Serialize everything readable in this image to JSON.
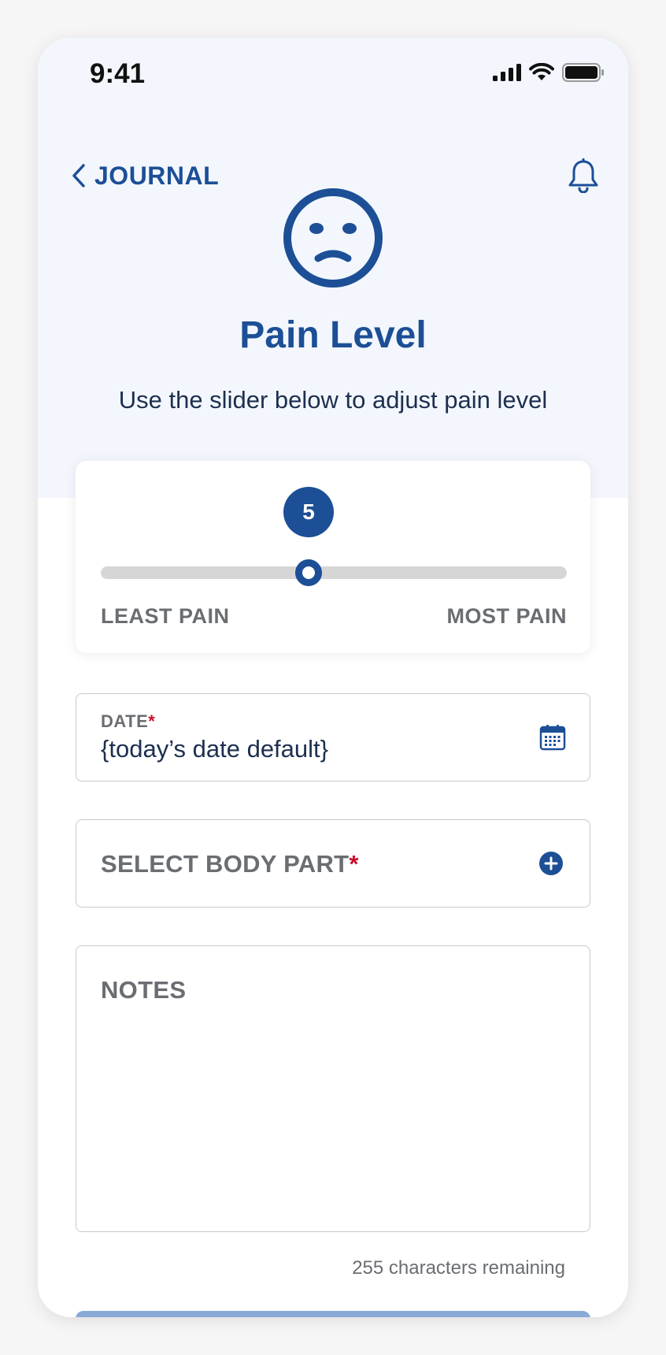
{
  "status_bar": {
    "time": "9:41",
    "icons": [
      "signal-icon",
      "wifi-icon",
      "battery-icon"
    ]
  },
  "nav": {
    "back_label": "JOURNAL",
    "back_icon": "chevron-left-icon",
    "notification_icon": "bell-icon"
  },
  "header": {
    "mood_icon": "sad-face-icon",
    "title": "Pain Level",
    "subtitle": "Use the slider below to adjust pain level"
  },
  "slider": {
    "value": "5",
    "value_fraction": 0.446,
    "min_label": "LEAST PAIN",
    "max_label": "MOST PAIN"
  },
  "form": {
    "date": {
      "label": "DATE",
      "required_mark": "*",
      "value": "{today’s date default}",
      "icon": "calendar-icon"
    },
    "body_part": {
      "label": "SELECT BODY PART",
      "required_mark": "*",
      "icon": "plus-circle-icon"
    },
    "notes": {
      "label": "NOTES",
      "remaining": "255 characters remaining"
    }
  },
  "colors": {
    "primary": "#1c4f96",
    "hero_background": "#f3f7fd",
    "required": "#c8102e",
    "muted_text": "#6a6d71",
    "submit_disabled": "#8aaad6"
  }
}
